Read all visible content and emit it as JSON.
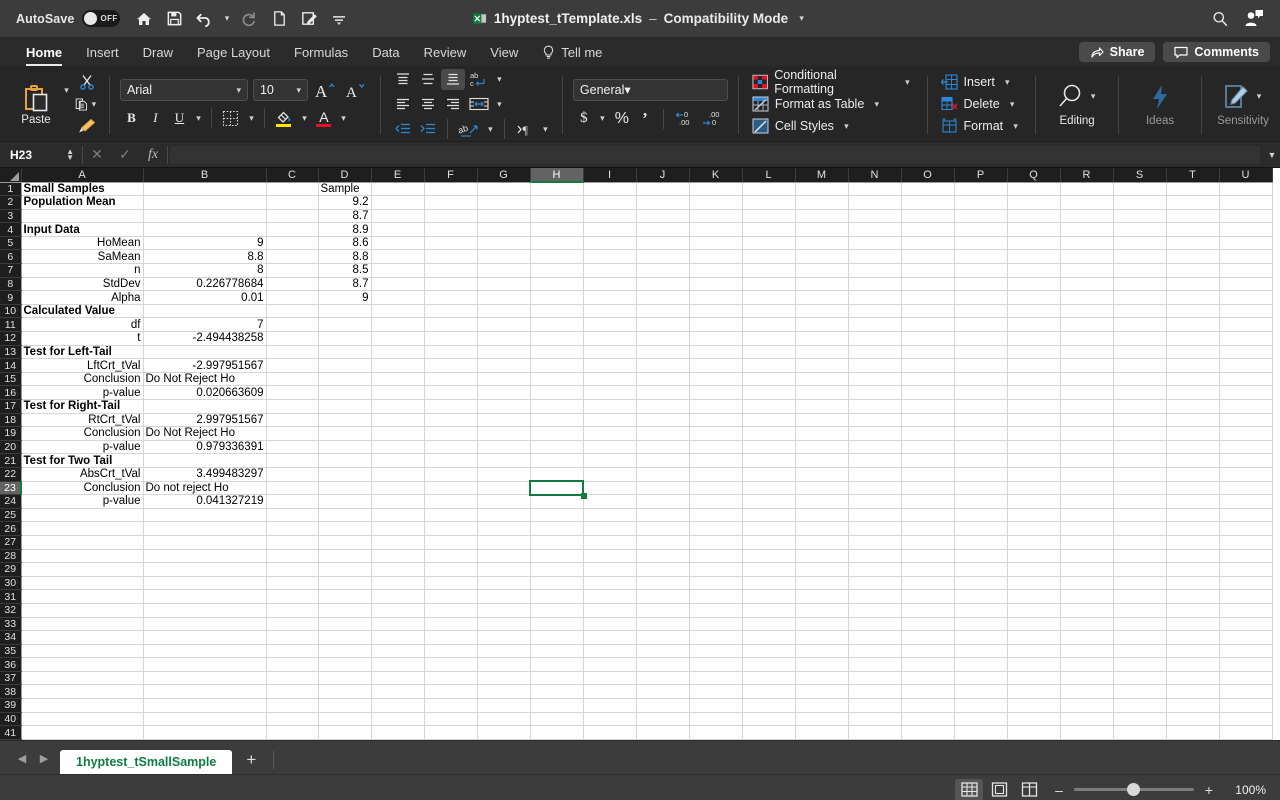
{
  "titlebar": {
    "autosave_label": "AutoSave",
    "autosave_state": "OFF",
    "doc_title": "1hyptest_tTemplate.xls",
    "separator": "–",
    "compat_mode": "Compatibility Mode",
    "quick_access": [
      {
        "name": "home-icon",
        "label": "Home"
      },
      {
        "name": "save-icon",
        "label": "Save"
      },
      {
        "name": "undo-icon",
        "label": "Undo"
      },
      {
        "name": "redo-icon",
        "label": "Redo"
      },
      {
        "name": "new-file-icon",
        "label": "New"
      },
      {
        "name": "edit-doc-icon",
        "label": "Edit Document"
      },
      {
        "name": "customize-toolbar-icon",
        "label": "Customize Quick Access Toolbar"
      }
    ],
    "search_icon": "search-icon",
    "account_icon": "account-icon"
  },
  "ribbon_tabs": {
    "tabs": [
      {
        "label": "Home",
        "active": true
      },
      {
        "label": "Insert",
        "active": false
      },
      {
        "label": "Draw",
        "active": false
      },
      {
        "label": "Page Layout",
        "active": false
      },
      {
        "label": "Formulas",
        "active": false
      },
      {
        "label": "Data",
        "active": false
      },
      {
        "label": "Review",
        "active": false
      },
      {
        "label": "View",
        "active": false
      }
    ],
    "tell_me": "Tell me",
    "share": "Share",
    "comments": "Comments"
  },
  "ribbon": {
    "clipboard": {
      "paste_label": "Paste",
      "cut_label": "Cut",
      "copy_label": "Copy",
      "format_painter_label": "Format Painter"
    },
    "font": {
      "family": "Arial",
      "size": "10",
      "grow_label": "Increase Font Size",
      "shrink_label": "Decrease Font Size",
      "bold": "B",
      "italic": "I",
      "underline": "U",
      "borders_label": "Borders",
      "fill_color_label": "Fill Color",
      "font_color_label": "Font Color",
      "fill_color": "#ffe600",
      "font_color": "#e81123"
    },
    "alignment": {
      "top_align": "Top Align",
      "middle_align": "Middle Align",
      "bottom_align": "Bottom Align",
      "wrap_text": "Wrap Text",
      "align_left": "Align Left",
      "align_center": "Center",
      "align_right": "Align Right",
      "merge_center": "Merge & Center",
      "decrease_indent": "Decrease Indent",
      "increase_indent": "Increase Indent",
      "orientation": "Orientation",
      "text_direction": "Text Direction"
    },
    "number": {
      "format": "General",
      "currency": "$",
      "percent": "%",
      "comma": "Comma Style",
      "decrease_decimal": "Decrease Decimal",
      "increase_decimal": "Increase Decimal"
    },
    "styles": [
      {
        "label": "Conditional Formatting",
        "icon": "conditional-formatting-icon"
      },
      {
        "label": "Format as Table",
        "icon": "format-as-table-icon"
      },
      {
        "label": "Cell Styles",
        "icon": "cell-styles-icon"
      }
    ],
    "cells": [
      {
        "label": "Insert",
        "icon": "insert-cells-icon"
      },
      {
        "label": "Delete",
        "icon": "delete-cells-icon"
      },
      {
        "label": "Format",
        "icon": "format-cells-icon"
      }
    ],
    "right_groups": [
      {
        "label": "Editing",
        "icon": "editing-magnifier-icon",
        "dim": false
      },
      {
        "label": "Ideas",
        "icon": "ideas-lightning-icon",
        "dim": true
      },
      {
        "label": "Sensitivity",
        "icon": "sensitivity-icon",
        "dim": true
      }
    ]
  },
  "formula_bar": {
    "name_box": "H23",
    "cancel_label": "Cancel",
    "enter_label": "Enter",
    "fx_label": "Insert Function",
    "formula_value": "",
    "expand_label": "Expand Formula Bar"
  },
  "grid": {
    "columns": [
      "A",
      "B",
      "C",
      "D",
      "E",
      "F",
      "G",
      "H",
      "I",
      "J",
      "K",
      "L",
      "M",
      "N",
      "O",
      "P",
      "Q",
      "R",
      "S",
      "T",
      "U"
    ],
    "active_column": "H",
    "active_row": 23,
    "active_cell": "H23",
    "total_rows": 43,
    "rows": [
      {
        "n": 1,
        "A": "Small Samples",
        "Abold": true,
        "B": "",
        "D": "Sample",
        "Dright": false
      },
      {
        "n": 2,
        "A": "Population Mean",
        "Abold": true,
        "B": "",
        "D": "9.2",
        "Dright": true
      },
      {
        "n": 3,
        "A": "",
        "Abold": false,
        "B": "",
        "D": "8.7",
        "Dright": true
      },
      {
        "n": 4,
        "A": "Input Data",
        "Abold": true,
        "B": "",
        "D": "8.9",
        "Dright": true
      },
      {
        "n": 5,
        "A": "HoMean",
        "Abold": false,
        "Aright": true,
        "B": "9",
        "Bright": true,
        "D": "8.6",
        "Dright": true
      },
      {
        "n": 6,
        "A": "SaMean",
        "Abold": false,
        "Aright": true,
        "B": "8.8",
        "Bright": true,
        "D": "8.8",
        "Dright": true
      },
      {
        "n": 7,
        "A": "n",
        "Abold": false,
        "Aright": true,
        "B": "8",
        "Bright": true,
        "D": "8.5",
        "Dright": true
      },
      {
        "n": 8,
        "A": "StdDev",
        "Abold": false,
        "Aright": true,
        "B": "0.226778684",
        "Bright": true,
        "D": "8.7",
        "Dright": true
      },
      {
        "n": 9,
        "A": "Alpha",
        "Abold": false,
        "Aright": true,
        "B": "0.01",
        "Bright": true,
        "D": "9",
        "Dright": true
      },
      {
        "n": 10,
        "A": "Calculated Value",
        "Abold": true,
        "B": "",
        "D": ""
      },
      {
        "n": 11,
        "A": "df",
        "Abold": false,
        "Aright": true,
        "B": "7",
        "Bright": true,
        "D": ""
      },
      {
        "n": 12,
        "A": "t",
        "Abold": false,
        "Aright": true,
        "B": "-2.494438258",
        "Bright": true,
        "D": ""
      },
      {
        "n": 13,
        "A": "Test for Left-Tail",
        "Abold": true,
        "B": "",
        "D": ""
      },
      {
        "n": 14,
        "A": "LftCrt_tVal",
        "Abold": false,
        "Aright": true,
        "B": "-2.997951567",
        "Bright": true,
        "D": ""
      },
      {
        "n": 15,
        "A": "Conclusion",
        "Abold": false,
        "Aright": true,
        "B": "Do Not Reject Ho",
        "Bright": false,
        "D": ""
      },
      {
        "n": 16,
        "A": "p-value",
        "Abold": false,
        "Aright": true,
        "B": "0.020663609",
        "Bright": true,
        "D": ""
      },
      {
        "n": 17,
        "A": "Test for Right-Tail",
        "Abold": true,
        "B": "",
        "D": ""
      },
      {
        "n": 18,
        "A": "RtCrt_tVal",
        "Abold": false,
        "Aright": true,
        "B": "2.997951567",
        "Bright": true,
        "D": ""
      },
      {
        "n": 19,
        "A": "Conclusion",
        "Abold": false,
        "Aright": true,
        "B": "Do Not Reject Ho",
        "Bright": false,
        "D": ""
      },
      {
        "n": 20,
        "A": "p-value",
        "Abold": false,
        "Aright": true,
        "B": "0.979336391",
        "Bright": true,
        "D": ""
      },
      {
        "n": 21,
        "A": "Test for Two Tail",
        "Abold": true,
        "B": "",
        "D": ""
      },
      {
        "n": 22,
        "A": "AbsCrt_tVal",
        "Abold": false,
        "Aright": true,
        "B": "3.499483297",
        "Bright": true,
        "D": ""
      },
      {
        "n": 23,
        "A": "Conclusion",
        "Abold": false,
        "Aright": true,
        "B": "Do not reject Ho",
        "Bright": false,
        "D": ""
      },
      {
        "n": 24,
        "A": "p-value",
        "Abold": false,
        "Aright": true,
        "B": "0.041327219",
        "Bright": true,
        "D": ""
      }
    ]
  },
  "sheet_tabs": {
    "prev_label": "Previous Sheet",
    "next_label": "Next Sheet",
    "active_sheet": "1hyptest_tSmallSample",
    "add_sheet": "+"
  },
  "status_bar": {
    "view_normal": "Normal View",
    "view_page_layout": "Page Layout View",
    "view_page_break": "Page Break Preview",
    "zoom_out": "–",
    "zoom_in": "+",
    "zoom_level": "100%",
    "zoom_value": 100
  }
}
